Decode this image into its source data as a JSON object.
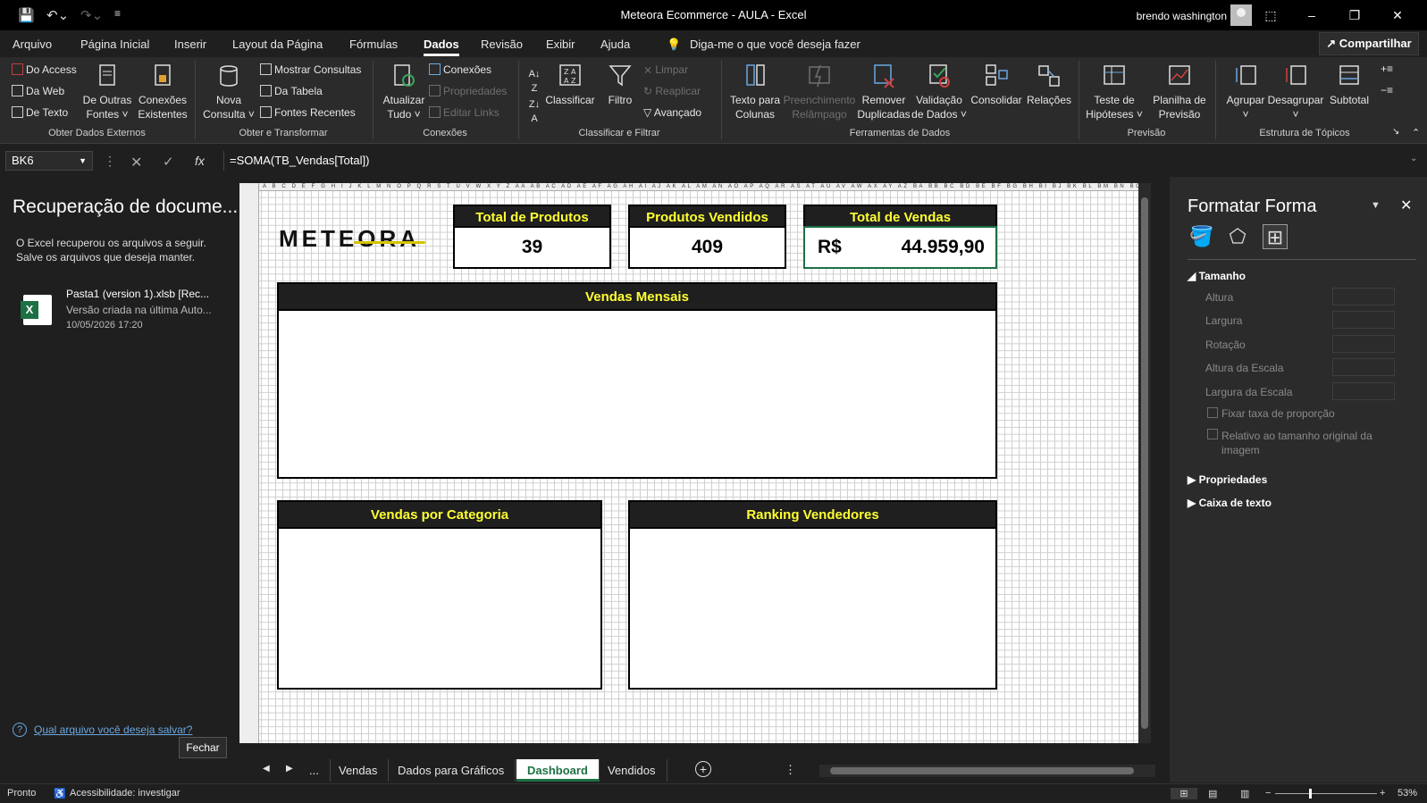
{
  "window": {
    "title": "Meteora Ecommerce - AULA  -  Excel",
    "user": "brendo washington"
  },
  "menu": {
    "tabs": [
      "Arquivo",
      "Página Inicial",
      "Inserir",
      "Layout da Página",
      "Fórmulas",
      "Dados",
      "Revisão",
      "Exibir",
      "Ajuda"
    ],
    "active_tab": "Dados",
    "tell_me": "Diga-me o que você deseja fazer",
    "share": "Compartilhar"
  },
  "ribbon": {
    "external": {
      "group": "Obter Dados Externos",
      "access": "Do Access",
      "web": "Da Web",
      "text": "De Texto",
      "other_sources": [
        "De Outras",
        "Fontes ˅"
      ],
      "existing": [
        "Conexões",
        "Existentes"
      ]
    },
    "transform": {
      "group": "Obter e Transformar",
      "new_query": [
        "Nova",
        "Consulta ˅"
      ],
      "show_queries": "Mostrar Consultas",
      "from_table": "Da Tabela",
      "recent_sources": "Fontes Recentes"
    },
    "connections": {
      "group": "Conexões",
      "refresh_all": [
        "Atualizar",
        "Tudo ˅"
      ],
      "connections": "Conexões",
      "properties": "Propriedades",
      "edit_links": "Editar Links"
    },
    "sort_filter": {
      "group": "Classificar e Filtrar",
      "sort": "Classificar",
      "filter": "Filtro",
      "clear": "Limpar",
      "reapply": "Reaplicar",
      "advanced": "Avançado"
    },
    "data_tools": {
      "group": "Ferramentas de Dados",
      "text_to_columns": [
        "Texto para",
        "Colunas"
      ],
      "flash_fill": [
        "Preenchimento",
        "Relâmpago"
      ],
      "remove_dups": [
        "Remover",
        "Duplicadas"
      ],
      "validation": [
        "Validação",
        "de Dados ˅"
      ],
      "consolidate": "Consolidar",
      "relations": "Relações"
    },
    "forecast": {
      "group": "Previsão",
      "what_if": [
        "Teste de",
        "Hipóteses ˅"
      ],
      "forecast_sheet": [
        "Planilha de",
        "Previsão"
      ]
    },
    "outline": {
      "group": "Estrutura de Tópicos",
      "group_btn": [
        "Agrupar",
        "˅"
      ],
      "ungroup": [
        "Desagrupar",
        "˅"
      ],
      "subtotal": "Subtotal"
    }
  },
  "formula_bar": {
    "name_box": "BK6",
    "formula": "=SOMA(TB_Vendas[Total])",
    "fx": "fx"
  },
  "recovery": {
    "title": "Recuperação de docume...",
    "desc1": "O Excel recuperou os arquivos a seguir.",
    "desc2": "Salve os arquivos que deseja manter.",
    "file_name": "Pasta1 (version 1).xlsb  [Rec...",
    "file_desc": "Versão criada na última Auto...",
    "file_date": "10/05/2026 17:20",
    "question": "Qual arquivo você deseja salvar?",
    "close": "Fechar"
  },
  "dashboard": {
    "logo": "METEORA",
    "kpis": [
      {
        "title": "Total de Produtos",
        "value": "39"
      },
      {
        "title": "Produtos  Vendidos",
        "value": "409"
      },
      {
        "title": "Total de Vendas",
        "currency": "R$",
        "value": "44.959,90"
      }
    ],
    "panels": {
      "monthly": "Vendas Mensais",
      "category": "Vendas por Categoria",
      "ranking": "Ranking Vendedores"
    },
    "column_header_text": "A B C D E F G H I J K L M N O P Q R S T U V W X Y Z AA AB AC AD AE AF AG AH AI AJ AK AL AM AN AO AP AQ AR AS AT AU AV AW AX AY AZ BA BB BC BD BE BF BG BH BI BJ BK BL BM BN BO BP BQ BR BS BT BU BV BW BX BY BZ CA CB CC CD CE CF CG CH CI CJ CK CL CM CN CO CP CQ CR CS CT"
  },
  "sheet_tabs": {
    "more": "...",
    "tabs": [
      "Vendas",
      "Dados para Gráficos",
      "Dashboard",
      "Vendidos"
    ],
    "active": "Dashboard"
  },
  "format_pane": {
    "title": "Formatar Forma",
    "size_section": "Tamanho",
    "fields": [
      "Altura",
      "Largura",
      "Rotação",
      "Altura da Escala",
      "Largura da Escala"
    ],
    "lock_ratio": "Fixar taxa de proporção",
    "relative": "Relativo ao tamanho original da imagem",
    "properties": "Propriedades",
    "textbox": "Caixa de texto"
  },
  "status": {
    "ready": "Pronto",
    "accessibility": "Acessibilidade: investigar",
    "zoom": "53%"
  },
  "colors": {
    "header_yellow": "#ffff33",
    "excel_green": "#1d7044"
  }
}
